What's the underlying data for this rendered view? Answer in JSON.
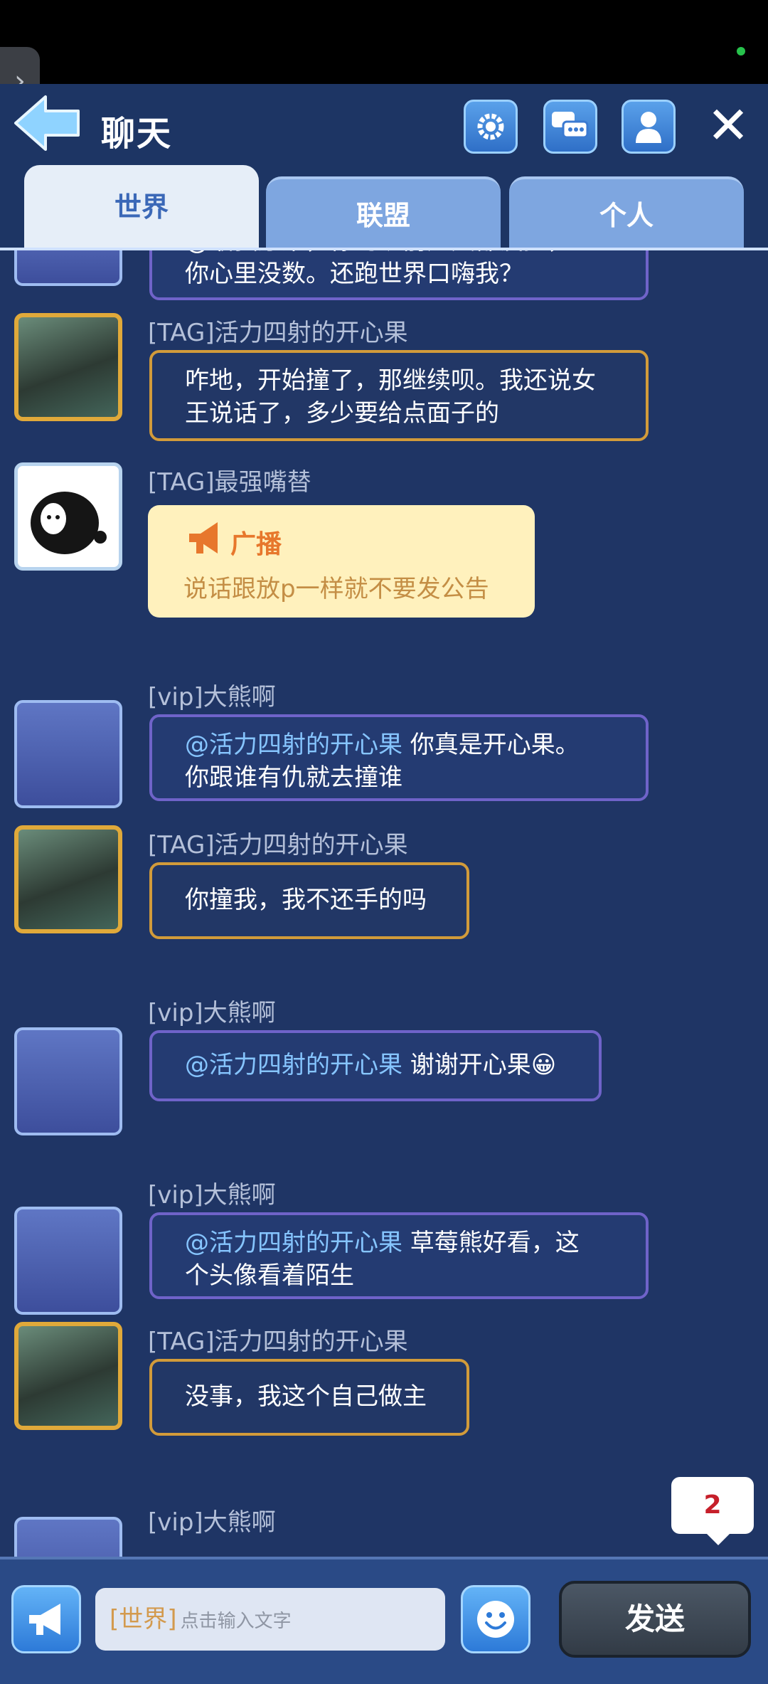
{
  "header": {
    "title": "聊天",
    "tabs": [
      {
        "label": "世界",
        "active": true
      },
      {
        "label": "联盟",
        "active": false
      },
      {
        "label": "个人",
        "active": false
      }
    ],
    "icons": [
      "back-arrow-icon",
      "gear-icon",
      "chat-bubbles-icon",
      "person-icon",
      "close-icon"
    ]
  },
  "messages": [
    {
      "sender": "",
      "text_lines": [
        "@最强厅某，你的矿前几天都没撞，",
        "你心里没数。还跑世界口嗨我？"
      ],
      "style": "blue",
      "partial": true
    },
    {
      "sender": "[TAG]活力四射的开心果",
      "text_lines": [
        "咋地，开始撞了，那继续呗。我还说女",
        "王说话了，多少要给点面子的"
      ],
      "style": "gold"
    },
    {
      "sender": "[TAG]最强嘴替",
      "broadcast_label": "广播",
      "broadcast_text": "说话跟放p一样就不要发公告"
    },
    {
      "sender": "[vip]大熊啊",
      "mention": "@活力四射的开心果",
      "text_first": " 你真是开心果。",
      "text_second": "你跟谁有仇就去撞谁",
      "style": "blue"
    },
    {
      "sender": "[TAG]活力四射的开心果",
      "text": "你撞我，我不还手的吗",
      "style": "gold"
    },
    {
      "sender": "[vip]大熊啊",
      "mention": "@活力四射的开心果",
      "text_first": " 谢谢开心果😀",
      "style": "blue"
    },
    {
      "sender": "[vip]大熊啊",
      "mention": "@活力四射的开心果",
      "text_first": " 草莓熊好看，这",
      "text_second": "个头像看着陌生",
      "style": "blue"
    },
    {
      "sender": "[TAG]活力四射的开心果",
      "text": "没事，我这个自己做主",
      "style": "gold"
    },
    {
      "sender": "[vip]大熊啊",
      "partial": true
    }
  ],
  "unread_count": "2",
  "composer": {
    "channel_prefix": "[世界]",
    "placeholder": "点击输入文字",
    "send_label": "发送"
  },
  "colors": {
    "background": "#1f3565",
    "mention": "#86c5ff",
    "gold_frame": "#d29b3a",
    "blue_frame": "#6f63c9",
    "broadcast_bg": "#fff1bd"
  }
}
